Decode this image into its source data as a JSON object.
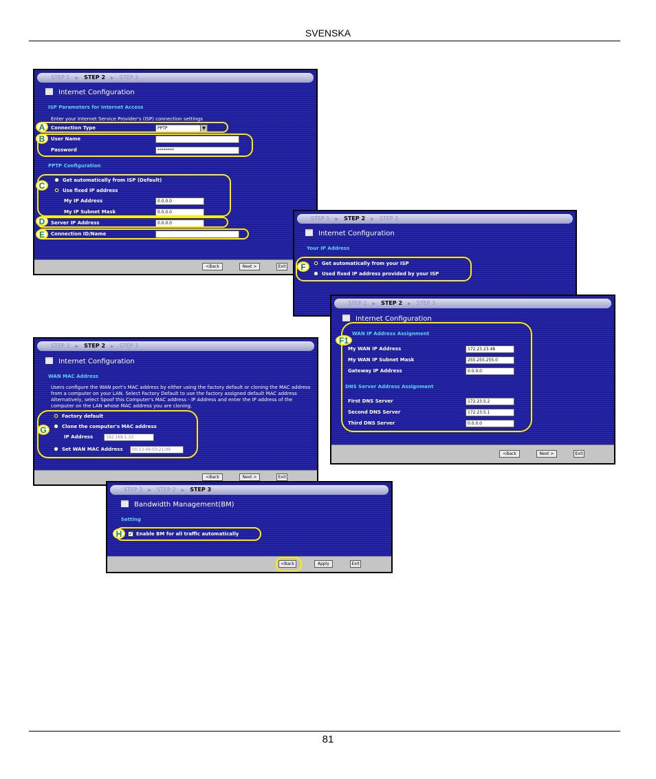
{
  "header": {
    "title": "SVENSKA"
  },
  "footer": {
    "page_number": "81"
  },
  "steps": {
    "step1": "STEP 1",
    "step2": "STEP 2",
    "step3": "STEP 3"
  },
  "common": {
    "back": "<Back",
    "next": "Next >",
    "exit": "Exit",
    "apply": "Apply",
    "page_title": "Internet Configuration"
  },
  "isp": {
    "section": "ISP Parameters for Internet Access",
    "intro": "Enter your Internet Service Provider's (ISP) connection settings",
    "connection_type_label": "Connection Type",
    "connection_type_value": "PPTP",
    "username_label": "User Name",
    "username_value": "",
    "password_label": "Password",
    "password_value": "********",
    "pptp_section": "PPTP Configuration",
    "get_auto": "Get automatically from ISP (Default)",
    "use_fixed": "Use fixed IP address",
    "my_ip_label": "My IP Address",
    "my_ip_value": "0.0.0.0",
    "my_mask_label": "My IP Subnet Mask",
    "my_mask_value": "0.0.0.0",
    "server_ip_label": "Server IP Address",
    "server_ip_value": "0.0.0.0",
    "conn_id_label": "Connection ID/Name",
    "conn_id_value": ""
  },
  "your_ip": {
    "section": "Your IP Address",
    "get_auto": "Get automatically from your ISP",
    "use_fixed": "Used fixed IP address provided by your ISP"
  },
  "wan_assign": {
    "section": "WAN IP Address Assignment",
    "wan_ip_label": "My WAN IP Address",
    "wan_ip_value": "172.23.23.48",
    "wan_mask_label": "My WAN IP Subnet Mask",
    "wan_mask_value": "255.255.255.0",
    "gateway_label": "Gateway IP Address",
    "gateway_value": "0.0.0.0",
    "dns_section": "DNS Server Address Assignment",
    "dns1_label": "First DNS Server",
    "dns1_value": "172.23.5.2",
    "dns2_label": "Second DNS Server",
    "dns2_value": "172.23.5.1",
    "dns3_label": "Third DNS Server",
    "dns3_value": "0.0.0.0"
  },
  "mac": {
    "section": "WAN MAC Address",
    "desc": "Users configure the WAN port's MAC address by either using the factory default or cloning the MAC address from a computer on your LAN. Select Factory Default to use the factory assigned default MAC address Alternatively, select Spoof this Computer's MAC address - IP Address and enter the IP address of the computer on the LAN whose MAC address you are cloning.",
    "factory": "Factory default",
    "clone": "Clone the computer's MAC address",
    "ip_label": "IP Address",
    "ip_value": "192.168.1.33",
    "set_wan": "Set WAN MAC Address",
    "set_wan_value": "00:13:49:03:21:09"
  },
  "bm": {
    "title": "Bandwidth Management(BM)",
    "section": "Setting",
    "enable": "Enable BM for all traffic automatically",
    "check_mark": "✓"
  },
  "badges": {
    "a": "A",
    "b": "B",
    "c": "C",
    "d": "D",
    "e": "E",
    "f": "F",
    "f1": "F1",
    "g": "G",
    "h": "H"
  },
  "colors": {
    "panel_blue": "#1c1c9c",
    "section_cyan": "#5ad2ff",
    "highlight_yellow": "#ffee00",
    "badge_green": "#1a8a1a"
  }
}
